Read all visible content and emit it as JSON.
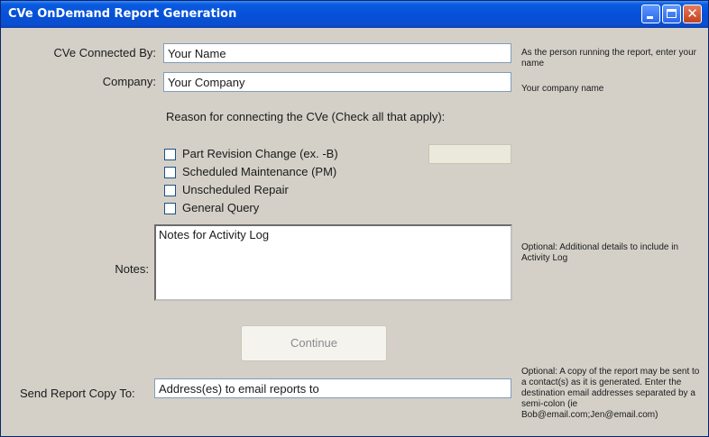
{
  "window": {
    "title": "CVe OnDemand Report Generation",
    "controls": {
      "minimize": "minimize-icon",
      "maximize": "maximize-icon",
      "close": "close-icon"
    },
    "close_glyph": "✕"
  },
  "form": {
    "connected_by": {
      "label": "CVe Connected By:",
      "value": "Your Name",
      "help": "As the person running the report, enter your name"
    },
    "company": {
      "label": "Company:",
      "value": "Your Company",
      "help": "Your company name"
    },
    "reason": {
      "heading": "Reason for connecting the CVe (Check all that apply):",
      "options": [
        {
          "label": "Part Revision Change (ex. -B)",
          "checked": false
        },
        {
          "label": "Scheduled Maintenance (PM)",
          "checked": false
        },
        {
          "label": "Unscheduled Repair",
          "checked": false
        },
        {
          "label": "General Query",
          "checked": false
        }
      ],
      "revision_field_value": ""
    },
    "notes": {
      "label": "Notes:",
      "value": "Notes for Activity Log",
      "help": "Optional: Additional details to include in Activity Log"
    },
    "continue_button": "Continue",
    "send_copy": {
      "label": "Send Report Copy To:",
      "value": "Address(es) to email reports to",
      "help": "Optional: A copy of the report may be sent to a contact(s) as it is generated. Enter the destination email addresses separated by a semi-colon (ie Bob@email.com;Jen@email.com)"
    }
  },
  "colors": {
    "titlebar": "#0551d8",
    "window_bg": "#d4d0c8",
    "textbox_border": "#7f9db9"
  }
}
